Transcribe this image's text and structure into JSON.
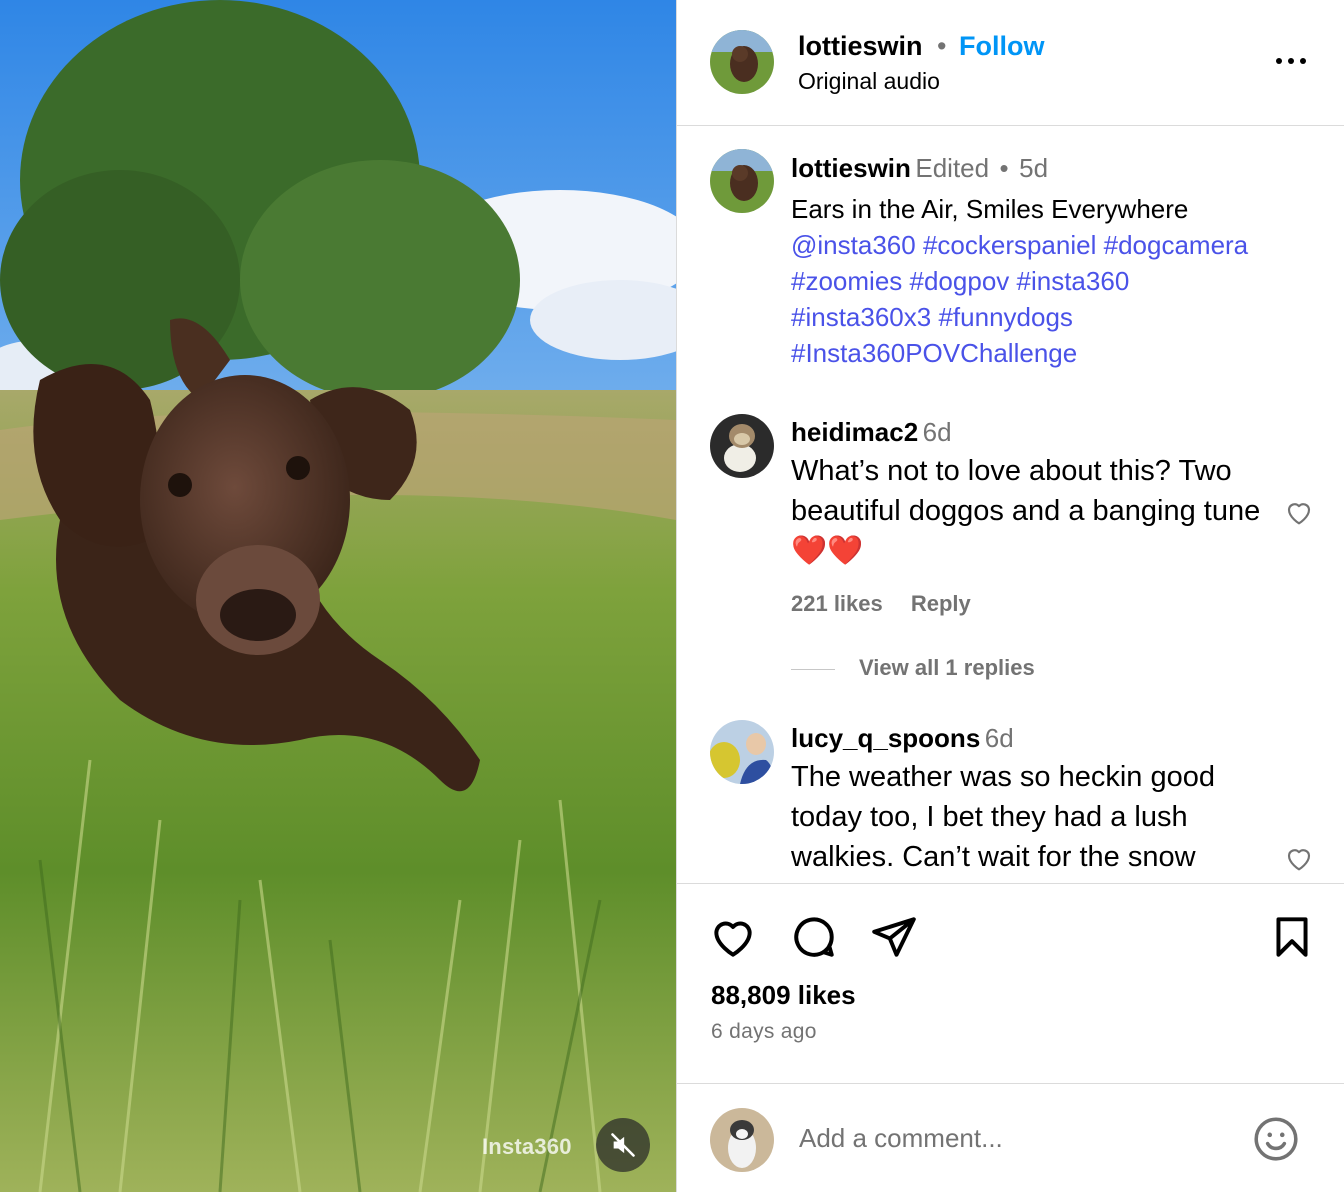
{
  "media": {
    "watermark": "Insta360",
    "mute_icon": "speaker-muted-icon"
  },
  "header": {
    "username": "lottieswin",
    "separator": "•",
    "follow_label": "Follow",
    "audio_label": "Original audio",
    "more_icon": "more-options-icon"
  },
  "caption": {
    "username": "lottieswin",
    "edited_label": "Edited",
    "separator": "•",
    "time": "5d",
    "text": "Ears in the Air, Smiles Everywhere",
    "tags": [
      "@insta360",
      "#cockerspaniel",
      "#dogcamera",
      "#zoomies",
      "#dogpov",
      "#insta360",
      "#insta360x3",
      "#funnydogs",
      "#Insta360POVChallenge"
    ]
  },
  "comments": [
    {
      "username": "heidimac2",
      "time": "6d",
      "text": "What’s not to love about this? Two beautiful doggos and a banging tune ❤️❤️",
      "likes": "221 likes",
      "reply_label": "Reply",
      "view_replies": "View all 1 replies"
    },
    {
      "username": "lucy_q_spoons",
      "time": "6d",
      "text": "The weather was so heckin good today too, I bet they had a lush walkies. Can’t wait for the snow"
    }
  ],
  "actions": {
    "like_icon": "heart-icon",
    "comment_icon": "comment-icon",
    "share_icon": "send-icon",
    "save_icon": "bookmark-icon",
    "likes_count": "88,809 likes",
    "posted_ago": "6 days ago"
  },
  "add_comment": {
    "placeholder": "Add a comment...",
    "emoji_icon": "emoji-icon"
  },
  "colors": {
    "link_blue": "#0095f6",
    "hashtag": "#4a52e8",
    "secondary_text": "#737373",
    "divider": "#dbdbdb"
  }
}
